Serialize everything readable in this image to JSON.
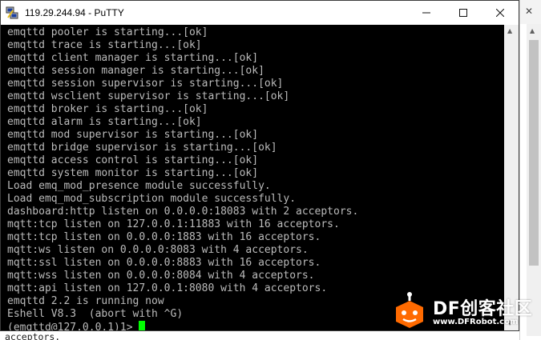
{
  "window": {
    "title": "119.29.244.94 - PuTTY"
  },
  "terminal": {
    "lines": [
      "emqttd pooler is starting...[ok]",
      "emqttd trace is starting...[ok]",
      "emqttd client manager is starting...[ok]",
      "emqttd session manager is starting...[ok]",
      "emqttd session supervisor is starting...[ok]",
      "emqttd wsclient supervisor is starting...[ok]",
      "emqttd broker is starting...[ok]",
      "emqttd alarm is starting...[ok]",
      "emqttd mod supervisor is starting...[ok]",
      "emqttd bridge supervisor is starting...[ok]",
      "emqttd access control is starting...[ok]",
      "emqttd system monitor is starting...[ok]",
      "Load emq_mod_presence module successfully.",
      "Load emq_mod_subscription module successfully.",
      "dashboard:http listen on 0.0.0.0:18083 with 2 acceptors.",
      "mqtt:tcp listen on 127.0.0.1:11883 with 16 acceptors.",
      "mqtt:tcp listen on 0.0.0.0:1883 with 16 acceptors.",
      "mqtt:ws listen on 0.0.0.0:8083 with 4 acceptors.",
      "mqtt:ssl listen on 0.0.0.0:8883 with 16 acceptors.",
      "mqtt:wss listen on 0.0.0.0:8084 with 4 acceptors.",
      "mqtt:api listen on 127.0.0.1:8080 with 4 acceptors.",
      "emqttd 2.2 is running now",
      "Eshell V8.3  (abort with ^G)"
    ],
    "prompt": "(emqttd@127.0.0.1)1> ",
    "cursor_color": "#00ff00",
    "text_color": "#bbbbbb",
    "background": "#000000"
  },
  "background_window": {
    "text": "acceptors."
  },
  "watermark": {
    "brand": "DF创客社区",
    "url": "www.DFRobot.com"
  },
  "icons": {
    "app": "putty-icon",
    "minimize": "minimize-icon",
    "maximize": "maximize-icon",
    "close": "close-icon"
  }
}
